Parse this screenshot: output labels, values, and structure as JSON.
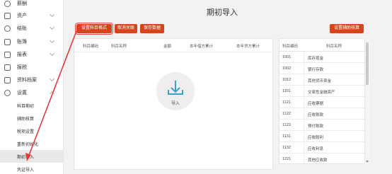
{
  "sidebar": {
    "top_item": {
      "label": "薪酬"
    },
    "items": [
      {
        "label": "资产",
        "icon": "asset-icon"
      },
      {
        "label": "结账",
        "icon": "closing-icon"
      },
      {
        "label": "账簿",
        "icon": "ledger-icon"
      },
      {
        "label": "报表",
        "icon": "report-icon"
      },
      {
        "label": "报税",
        "icon": "tax-icon"
      },
      {
        "label": "资料档案",
        "icon": "archive-icon"
      },
      {
        "label": "设置",
        "icon": "gear-icon"
      }
    ],
    "sub_items": [
      {
        "label": "科目期初"
      },
      {
        "label": "辅助核算"
      },
      {
        "label": "税项设置"
      },
      {
        "label": "重新初始化"
      },
      {
        "label": "期初导入"
      },
      {
        "label": "凭证导入"
      }
    ]
  },
  "main": {
    "title": "期初导入",
    "buttons": {
      "set_format": "设置科目格式",
      "cancel_link": "取消关联",
      "save_data": "保存数据",
      "set_aux": "设置辅助核算"
    },
    "table_headers": [
      "科目编码",
      "科目名称",
      "金额",
      "本年借方累计",
      "本年贷方累计"
    ],
    "import_label": "导入",
    "right_headers": [
      "科目编码",
      "科目名称"
    ],
    "right_rows": [
      {
        "code": "1001",
        "name": "库存现金"
      },
      {
        "code": "1002",
        "name": "银行存款"
      },
      {
        "code": "1012",
        "name": "其他货币资金"
      },
      {
        "code": "1101",
        "name": "交易性金融资产"
      },
      {
        "code": "1121",
        "name": "应收票据"
      },
      {
        "code": "1122",
        "name": "应收账款"
      },
      {
        "code": "1123",
        "name": "预付账款"
      },
      {
        "code": "1131",
        "name": "应收股利"
      },
      {
        "code": "1132",
        "name": "应收利息"
      },
      {
        "code": "1221",
        "name": "其他应收款"
      }
    ]
  },
  "colors": {
    "accent": "#d9431b",
    "arrow": "#e23b3b"
  }
}
